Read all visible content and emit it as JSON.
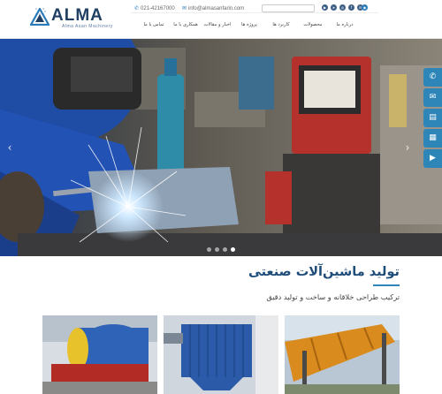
{
  "header": {
    "logo": {
      "name": "ALMA",
      "tagline": "Alma Asan Machinery"
    },
    "phone": "021-42167000",
    "email": "info@almasanfarin.com",
    "search": {
      "placeholder": ""
    },
    "social_icons": [
      "youtube-icon",
      "telegram-icon",
      "instagram-icon",
      "facebook-icon",
      "linkedin-icon"
    ],
    "language": "language-icon"
  },
  "nav": {
    "items": [
      "درباره ما",
      "محصولات",
      "کاربرد ها",
      "پروژه ها",
      "اخبار و مقالات",
      "همکاری با ما",
      "تماس با ما"
    ]
  },
  "hero": {
    "slides_count": 4,
    "active_slide": 4,
    "prev_icon": "chevron-left-icon",
    "next_icon": "chevron-right-icon"
  },
  "side_bar": {
    "icons": [
      "phone-icon",
      "email-icon",
      "catalog-icon",
      "document-icon",
      "video-icon"
    ]
  },
  "intro": {
    "title": "تولید ماشین‌آلات صنعتی",
    "subtitle": "ترکیب طراحی خلاقانه و ساخت و تولید دقیق"
  },
  "cards": [
    {
      "name": "ball-mill-image"
    },
    {
      "name": "dust-collector-image"
    },
    {
      "name": "rotary-dryer-image"
    }
  ],
  "colors": {
    "brand": "#1f3f63",
    "accent": "#2e86b8",
    "title": "#1f4d7a"
  }
}
